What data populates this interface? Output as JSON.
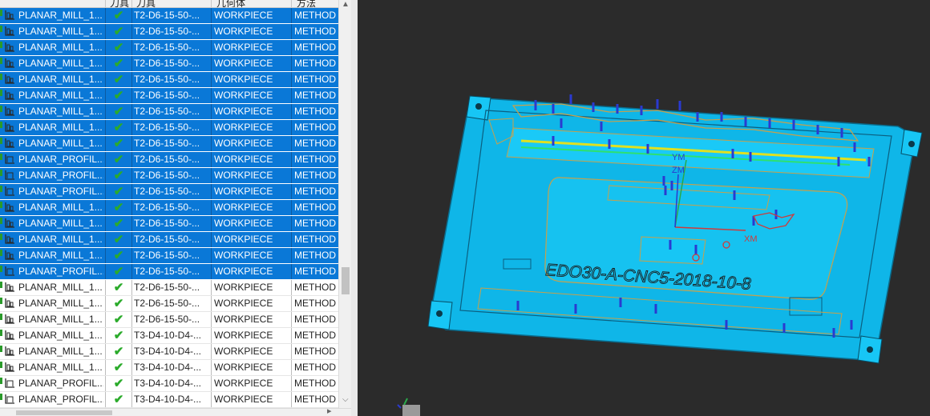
{
  "navigator": {
    "columns": {
      "name": "",
      "status": "刀具",
      "tool": "刀具",
      "geometry": "几何体",
      "method": "方法"
    },
    "rows": [
      {
        "name": "PLANAR_MILL_1...",
        "status": "✔",
        "tool": "T2-D6-15-50-...",
        "geometry": "WORKPIECE",
        "method": "METHOD",
        "selected": true,
        "kind": "mill"
      },
      {
        "name": "PLANAR_MILL_1...",
        "status": "✔",
        "tool": "T2-D6-15-50-...",
        "geometry": "WORKPIECE",
        "method": "METHOD",
        "selected": true,
        "kind": "mill"
      },
      {
        "name": "PLANAR_MILL_1...",
        "status": "✔",
        "tool": "T2-D6-15-50-...",
        "geometry": "WORKPIECE",
        "method": "METHOD",
        "selected": true,
        "kind": "mill"
      },
      {
        "name": "PLANAR_MILL_1...",
        "status": "✔",
        "tool": "T2-D6-15-50-...",
        "geometry": "WORKPIECE",
        "method": "METHOD",
        "selected": true,
        "kind": "mill"
      },
      {
        "name": "PLANAR_MILL_1...",
        "status": "✔",
        "tool": "T2-D6-15-50-...",
        "geometry": "WORKPIECE",
        "method": "METHOD",
        "selected": true,
        "kind": "mill"
      },
      {
        "name": "PLANAR_MILL_1...",
        "status": "✔",
        "tool": "T2-D6-15-50-...",
        "geometry": "WORKPIECE",
        "method": "METHOD",
        "selected": true,
        "kind": "mill"
      },
      {
        "name": "PLANAR_MILL_1...",
        "status": "✔",
        "tool": "T2-D6-15-50-...",
        "geometry": "WORKPIECE",
        "method": "METHOD",
        "selected": true,
        "kind": "mill"
      },
      {
        "name": "PLANAR_MILL_1...",
        "status": "✔",
        "tool": "T2-D6-15-50-...",
        "geometry": "WORKPIECE",
        "method": "METHOD",
        "selected": true,
        "kind": "mill"
      },
      {
        "name": "PLANAR_MILL_1...",
        "status": "✔",
        "tool": "T2-D6-15-50-...",
        "geometry": "WORKPIECE",
        "method": "METHOD",
        "selected": true,
        "kind": "mill"
      },
      {
        "name": "PLANAR_PROFIL...",
        "status": "✔",
        "tool": "T2-D6-15-50-...",
        "geometry": "WORKPIECE",
        "method": "METHOD",
        "selected": true,
        "kind": "profile"
      },
      {
        "name": "PLANAR_PROFIL...",
        "status": "✔",
        "tool": "T2-D6-15-50-...",
        "geometry": "WORKPIECE",
        "method": "METHOD",
        "selected": true,
        "kind": "profile"
      },
      {
        "name": "PLANAR_PROFIL...",
        "status": "✔",
        "tool": "T2-D6-15-50-...",
        "geometry": "WORKPIECE",
        "method": "METHOD",
        "selected": true,
        "kind": "profile"
      },
      {
        "name": "PLANAR_MILL_1...",
        "status": "✔",
        "tool": "T2-D6-15-50-...",
        "geometry": "WORKPIECE",
        "method": "METHOD",
        "selected": true,
        "kind": "mill"
      },
      {
        "name": "PLANAR_MILL_1...",
        "status": "✔",
        "tool": "T2-D6-15-50-...",
        "geometry": "WORKPIECE",
        "method": "METHOD",
        "selected": true,
        "kind": "mill"
      },
      {
        "name": "PLANAR_MILL_1...",
        "status": "✔",
        "tool": "T2-D6-15-50-...",
        "geometry": "WORKPIECE",
        "method": "METHOD",
        "selected": true,
        "kind": "mill"
      },
      {
        "name": "PLANAR_MILL_1...",
        "status": "✔",
        "tool": "T2-D6-15-50-...",
        "geometry": "WORKPIECE",
        "method": "METHOD",
        "selected": true,
        "kind": "mill"
      },
      {
        "name": "PLANAR_PROFIL...",
        "status": "✔",
        "tool": "T2-D6-15-50-...",
        "geometry": "WORKPIECE",
        "method": "METHOD",
        "selected": true,
        "kind": "profile"
      },
      {
        "name": "PLANAR_MILL_1...",
        "status": "✔",
        "tool": "T2-D6-15-50-...",
        "geometry": "WORKPIECE",
        "method": "METHOD",
        "selected": false,
        "kind": "mill"
      },
      {
        "name": "PLANAR_MILL_1...",
        "status": "✔",
        "tool": "T2-D6-15-50-...",
        "geometry": "WORKPIECE",
        "method": "METHOD",
        "selected": false,
        "kind": "mill"
      },
      {
        "name": "PLANAR_MILL_1...",
        "status": "✔",
        "tool": "T2-D6-15-50-...",
        "geometry": "WORKPIECE",
        "method": "METHOD",
        "selected": false,
        "kind": "mill"
      },
      {
        "name": "PLANAR_MILL_1...",
        "status": "✔",
        "tool": "T3-D4-10-D4-...",
        "geometry": "WORKPIECE",
        "method": "METHOD",
        "selected": false,
        "kind": "mill"
      },
      {
        "name": "PLANAR_MILL_1...",
        "status": "✔",
        "tool": "T3-D4-10-D4-...",
        "geometry": "WORKPIECE",
        "method": "METHOD",
        "selected": false,
        "kind": "mill"
      },
      {
        "name": "PLANAR_MILL_1...",
        "status": "✔",
        "tool": "T3-D4-10-D4-...",
        "geometry": "WORKPIECE",
        "method": "METHOD",
        "selected": false,
        "kind": "mill"
      },
      {
        "name": "PLANAR_PROFIL...",
        "status": "✔",
        "tool": "T3-D4-10-D4-...",
        "geometry": "WORKPIECE",
        "method": "METHOD",
        "selected": false,
        "kind": "profile"
      },
      {
        "name": "PLANAR_PROFIL...",
        "status": "✔",
        "tool": "T3-D4-10-D4-...",
        "geometry": "WORKPIECE",
        "method": "METHOD",
        "selected": false,
        "kind": "profile"
      }
    ]
  },
  "viewport": {
    "part_engraving": "EDO30-A-CNC5-2018-10-8",
    "axis_labels": {
      "ym": "YM",
      "zm": "ZM",
      "xm": "XM"
    },
    "colors": {
      "background": "#2b2b2b",
      "part": "#16c2f0",
      "toolpath": "#c8a04a",
      "tool_marker": "#2a3ad0",
      "selection": "#0a78d7",
      "check": "#2bab2b"
    }
  }
}
